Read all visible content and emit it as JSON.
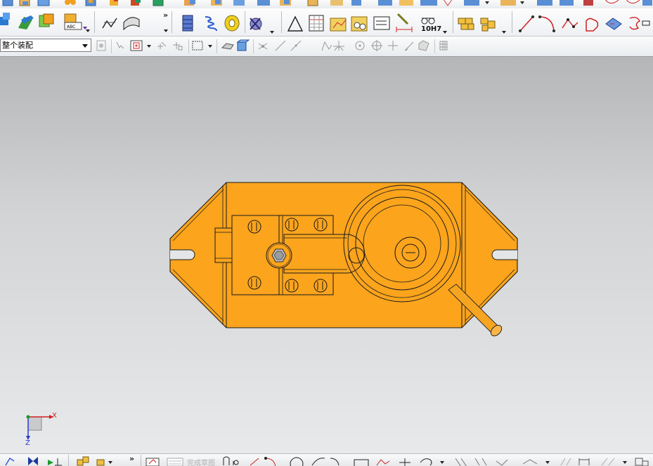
{
  "toolbar_row2": {
    "tolerance_label": "10H7",
    "overflow_chevron": "»"
  },
  "selection_bar": {
    "filter_value": "整个装配"
  },
  "bottom_bar": {
    "overflow_chevron": "»",
    "faded_command_label": "完成草图"
  },
  "triad": {
    "x_label": "X",
    "z_label": "Z"
  },
  "colors": {
    "part_fill": "#fba41c",
    "part_outline": "#1a1a1a",
    "handle_fill": "#f7a520",
    "axis_red": "#d02020",
    "axis_green": "#1a9a2a",
    "axis_blue": "#2a3ad0"
  },
  "icons": {
    "row1": [
      "sketch-icon",
      "extrude-icon",
      "revolve-icon",
      "pattern-icon",
      "assembly-icon",
      "component-icon",
      "mirror-icon",
      "mate-icon",
      "body-icon",
      "surface-icon",
      "shell-icon",
      "draft-icon",
      "blend-icon",
      "measure-icon",
      "view-icon",
      "snap-icon"
    ],
    "row2": [
      "part-icon",
      "edit-part-icon",
      "replace-icon",
      "label-icon",
      "curve-icon",
      "cylinder-icon",
      "spring-icon",
      "bearing-icon",
      "gear-icon",
      "triangle-icon",
      "table-icon",
      "chart-icon",
      "layout-icon",
      "note-icon",
      "dimension-icon",
      "tolerance-icon",
      "stock-icon",
      "stock-alt-icon",
      "line-icon",
      "arc-icon",
      "spline-icon",
      "profile-icon",
      "sketch-edit-icon",
      "trim-icon"
    ],
    "row3": [
      "filter-icon",
      "select-icon",
      "snap-point-icon",
      "snap-end-icon",
      "box-select-icon",
      "wire-view-icon",
      "shaded-view-icon",
      "point-icon",
      "line-snap-icon",
      "curve-snap-icon",
      "intersect-icon",
      "tangent-icon",
      "circle-center-icon",
      "quadrant-icon",
      "cross-icon",
      "angle-icon",
      "sketch-plane-icon",
      "grid-icon"
    ],
    "bottom": [
      "view-fit-icon",
      "orient-icon",
      "axis-icon",
      "component-icon",
      "assembly-icon",
      "sketch-icon",
      "finish-sketch-icon",
      "profile-icon",
      "line-icon",
      "arc-icon",
      "circle-icon",
      "rectangle-icon",
      "polygon-icon",
      "point-icon",
      "fillet-icon",
      "trim-icon",
      "extend-icon",
      "constraint-icon",
      "dimension-icon",
      "grid-icon"
    ]
  }
}
